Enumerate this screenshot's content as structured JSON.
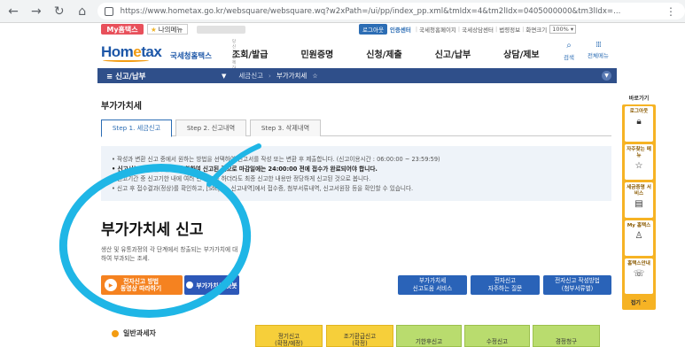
{
  "browser": {
    "url": "https://www.hometax.go.kr/websquare/websquare.wq?w2xPath=/ui/pp/index_pp.xml&tmIdx=4&tm2lIdx=0405000000&tm3lIdx=..."
  },
  "util": {
    "my_hometax": "My홈택스",
    "my_menu": "나의메뉴",
    "logout": "로그아웃",
    "cert_center": "인증센터",
    "links": [
      "국세청홈페이지",
      "국세상담센터",
      "법령정보",
      "화면크기"
    ],
    "zoom": "100%"
  },
  "header": {
    "logo_sub": "당신과 함께하는",
    "logo_main_pre": "Hom",
    "logo_main_e": "e",
    "logo_main_post": "tax",
    "logo_kr": "국세청홈택스",
    "gnb": [
      "조회/발급",
      "민원증명",
      "신청/제출",
      "신고/납부",
      "상담/제보"
    ],
    "search_label": "검색",
    "all_menu_label": "전체메뉴"
  },
  "location": {
    "title": "신고/납부",
    "crumbs": [
      "세금신고",
      "부가가치세"
    ]
  },
  "page": {
    "title": "부가가치세",
    "tabs": [
      "Step 1. 세금신고",
      "Step 2. 신고내역",
      "Step 3. 삭제내역"
    ],
    "info_lines": [
      "작성과 변환 신고 중에서 원하는 방법을 선택하여 신고서를 작성 또는 변환 후 제출합니다. (신고이용시간 : 06:00:00 ~ 23:59:59)",
      "신고서는 정상 접수된 것에 한하여 신고된 것으로 마감일에는 24:00:00 전에 접수가 완료되어야 합니다.",
      "신고기간 중 신고기한 내에 여러 번 신고를 하더라도 최종 신고한 내용만 정당하게 신고된 것으로 봅니다.",
      "신고 후 접수결과(정상)를 확인하고, [Step 2. 신고내역]에서 접수증, 첨부서류내역, 신고서원장 등을 확인할 수 있습니다."
    ],
    "hero_title": "부가가치세 신고",
    "hero_desc": "생산 및 유통과정의 각 단계에서 창출되는 부가가치에 대하여 부과되는 조세.",
    "btn_video_line1": "전자신고 방법",
    "btn_video_line2": "동영상 따라하기",
    "btn_chat": "부가가치세 챗봇",
    "quick_buttons": [
      {
        "line1": "부가가치세",
        "line2": "신고도움 서비스"
      },
      {
        "line1": "전자신고",
        "line2": "자주하는 질문"
      },
      {
        "line1": "전자신고 작성방법",
        "line2": "(첨부서류별)"
      }
    ],
    "section_label": "일반과세자",
    "yellow_tabs": [
      {
        "line1": "정기신고",
        "line2": "(확정/예정)"
      },
      {
        "line1": "조기환급신고",
        "line2": "(확정)"
      }
    ],
    "green_tabs": [
      "기한후신고",
      "수정신고",
      "경정청구"
    ]
  },
  "sidebar": {
    "title": "바로가기",
    "items": [
      {
        "label": "로그아웃",
        "icon": "lock-icon"
      },
      {
        "label": "자주찾는 메뉴",
        "icon": "star-icon"
      },
      {
        "label": "세금증명 서비스",
        "icon": "document-icon"
      },
      {
        "label": "My 홈택스",
        "icon": "person-icon"
      },
      {
        "label": "홈택스안내",
        "icon": "guide-icon"
      }
    ],
    "bottom": "접기 ^"
  },
  "colors": {
    "brand_blue": "#1d57a8",
    "nav_bar": "#2f4f8a",
    "orange": "#f58220",
    "sidebar_yellow": "#f6b324",
    "annotation_cyan": "#1fb6e6"
  }
}
